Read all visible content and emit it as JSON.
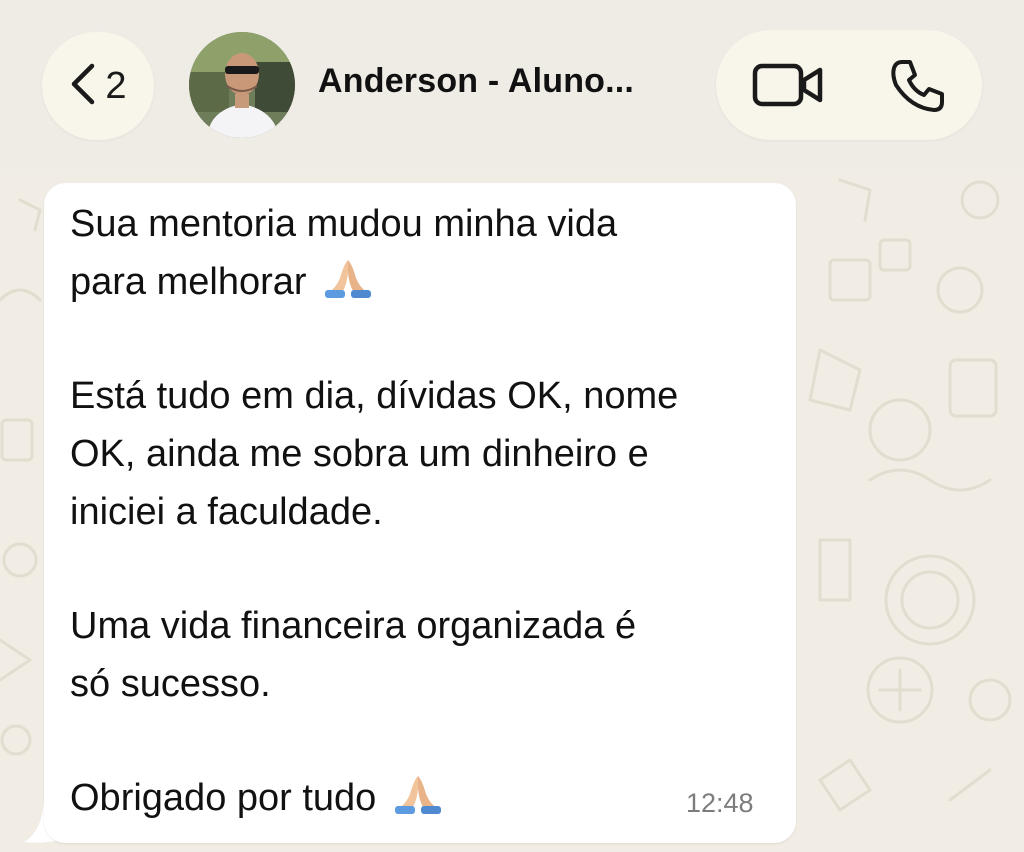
{
  "header": {
    "back_count": "2",
    "contact_name": "Anderson - Aluno...",
    "avatar_icon": "contact-avatar-photo",
    "video_icon": "video-camera-icon",
    "call_icon": "phone-icon"
  },
  "message": {
    "line1": "Sua mentoria mudou minha vida",
    "line2": "para melhorar",
    "line3": "Está tudo em dia, dívidas OK, nome",
    "line4": "OK, ainda me sobra um dinheiro e",
    "line5": "iniciei a faculdade.",
    "line6": "Uma vida financeira organizada é",
    "line7": "só sucesso.",
    "line8": "Obrigado por tudo",
    "emoji": "folded-hands-emoji",
    "time": "12:48"
  },
  "colors": {
    "wallpaper": "#f1ede4",
    "bubble": "#ffffff",
    "pill": "#f8f5ea",
    "text": "#111111",
    "timestamp": "#7c7c7c"
  }
}
